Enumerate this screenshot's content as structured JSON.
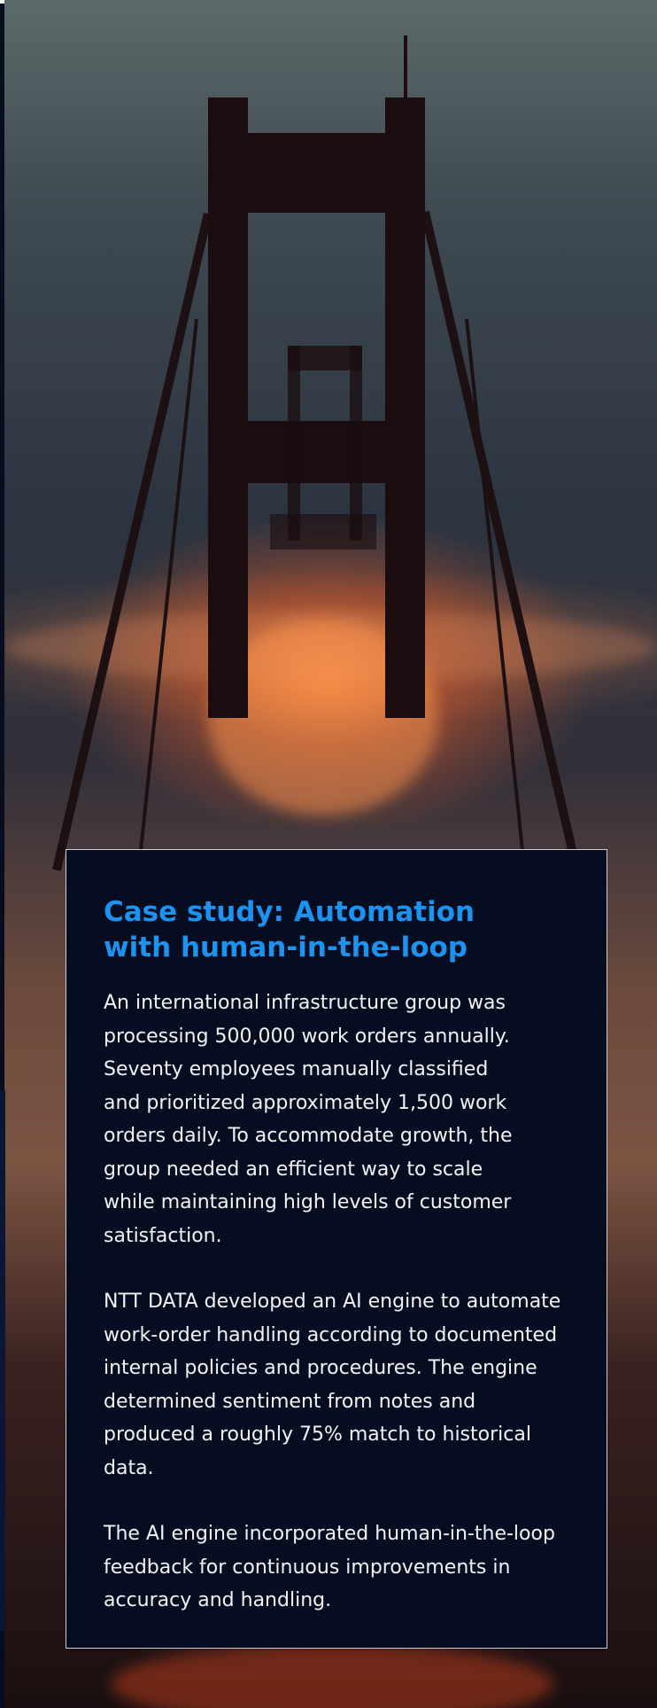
{
  "hero_image": {
    "description_icon": "golden-gate-bridge-fog-image"
  },
  "colors": {
    "heading": "#1d93f0",
    "card_background": "#070d20",
    "card_border": "#c9ccd6",
    "body_text": "#f2f3f6"
  },
  "case_study": {
    "title": "Case study: Automation with human-in-the-loop",
    "paragraphs": [
      "An international infrastructure group was processing 500,000 work orders annually. Seventy employees manually classified and prioritized approximately 1,500 work orders daily. To accommodate growth, the group needed an efficient way to scale while maintaining high levels of customer satisfaction.",
      "NTT DATA developed an AI engine to automate work-order handling according to documented internal policies and procedures. The engine determined sentiment from notes and produced a roughly 75% match to historical data.",
      "The AI engine incorporated human-in-the-loop feedback for continuous improvements in accuracy and handling."
    ]
  }
}
